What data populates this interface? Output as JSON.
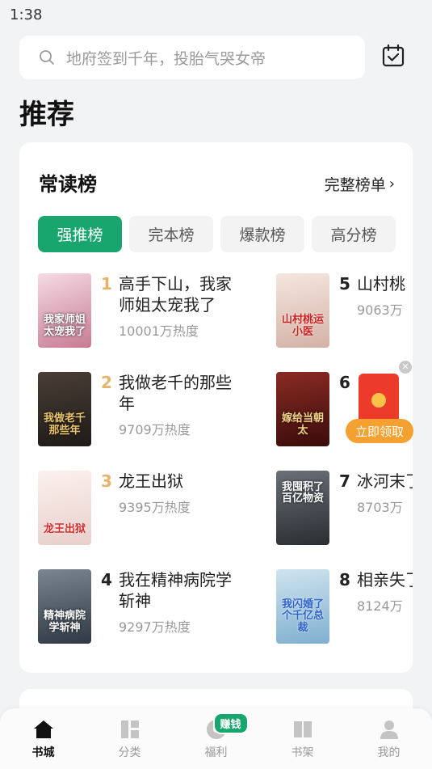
{
  "status": {
    "time": "1:38"
  },
  "search": {
    "placeholder": "地府签到千年，投胎气哭女帝",
    "checkin_icon": "calendar-check-icon"
  },
  "page": {
    "title": "推荐"
  },
  "chart": {
    "title": "常读榜",
    "full_list": "完整榜单",
    "tabs": [
      "强推榜",
      "完本榜",
      "爆款榜",
      "高分榜"
    ],
    "active_tab": 0
  },
  "books": [
    {
      "rank": "1",
      "title": "高手下山，我家师姐太宠我了",
      "heat": "10001万热度",
      "cover_text": "我家师姐太宠我了",
      "cover_color": "#e9b7c4"
    },
    {
      "rank": "2",
      "title": "我做老千的那些年",
      "heat": "9709万热度",
      "cover_text": "我做老千那些年",
      "cover_color": "#2b2420"
    },
    {
      "rank": "3",
      "title": "龙王出狱",
      "heat": "9395万热度",
      "cover_text": "龙王出狱",
      "cover_color": "#efe3e0"
    },
    {
      "rank": "4",
      "title": "我在精神病院学斩神",
      "heat": "9297万热度",
      "cover_text": "精神病院学斩神",
      "cover_color": "#4a5563"
    },
    {
      "rank": "5",
      "title": "山村桃",
      "heat": "9063万",
      "cover_text": "山村桃运小医",
      "cover_color": "#e7d2cb"
    },
    {
      "rank": "6",
      "title": "",
      "heat": "",
      "cover_text": "嫁给当朝太",
      "cover_color": "#5a1515"
    },
    {
      "rank": "7",
      "title": "冰河末了百亿",
      "heat": "8703万",
      "cover_text": "我囤积了百亿物资",
      "cover_color": "#3d4147"
    },
    {
      "rank": "8",
      "title": "相亲失了个千",
      "heat": "8124万",
      "cover_text": "我闪婚了个千亿总裁",
      "cover_color": "#9fc5dd"
    }
  ],
  "red_packet": {
    "button": "立即领取"
  },
  "nav": [
    {
      "label": "书城",
      "icon": "home-icon"
    },
    {
      "label": "分类",
      "icon": "category-icon"
    },
    {
      "label": "福利",
      "icon": "welfare-icon",
      "badge": "赚钱"
    },
    {
      "label": "书架",
      "icon": "bookshelf-icon"
    },
    {
      "label": "我的",
      "icon": "profile-icon"
    }
  ],
  "colors": {
    "accent": "#18a56e",
    "rank_gold": "#e7b26a",
    "red_packet": "#ec3b2b",
    "claim_button": "#f5a131"
  }
}
